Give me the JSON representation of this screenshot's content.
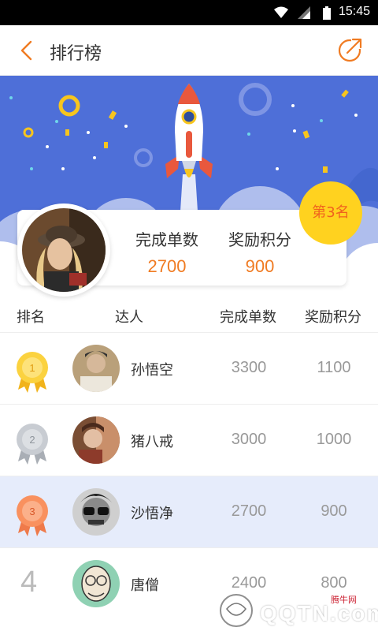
{
  "status_bar": {
    "time": "15:45"
  },
  "header": {
    "title": "排行榜"
  },
  "my_summary": {
    "rank_badge": "第3名",
    "orders_label": "完成单数",
    "orders_value": "2700",
    "points_label": "奖励积分",
    "points_value": "900"
  },
  "table": {
    "columns": [
      "排名",
      "达人",
      "完成单数",
      "奖励积分"
    ],
    "rows": [
      {
        "rank": "1",
        "name": "孙悟空",
        "orders": "3300",
        "points": "1100"
      },
      {
        "rank": "2",
        "name": "猪八戒",
        "orders": "3000",
        "points": "1000"
      },
      {
        "rank": "3",
        "name": "沙悟净",
        "orders": "2700",
        "points": "900"
      },
      {
        "rank": "4",
        "name": "唐僧",
        "orders": "2400",
        "points": "800"
      }
    ]
  },
  "colors": {
    "accent": "#f07b22",
    "banner": "#4e6fd8",
    "highlight_row": "#e6ecfb",
    "gold": "#ffd21f"
  },
  "watermark": {
    "brand": "QQTN.com",
    "small": "腾牛网"
  }
}
